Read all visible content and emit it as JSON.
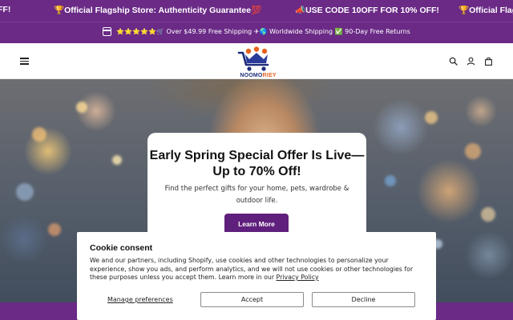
{
  "announcement": {
    "items": [
      "FF!",
      "🏆Official Flagship Store: Authenticity Guarantee💯",
      "📣USE CODE 10OFF FOR 10% OFF!",
      "🏆Official Flagsh"
    ]
  },
  "shipping_bar": {
    "icon": "calendar-icon",
    "text": "⭐⭐⭐⭐⭐🛒 Over $49.99 Free Shipping ✈🌎 Worldwide Shipping ✅ 90-Day Free Returns"
  },
  "header": {
    "logo_text_primary": "NOOMO",
    "logo_text_accent": "RIEY",
    "icons": [
      "menu-icon",
      "search-icon",
      "account-icon",
      "cart-icon"
    ],
    "brand_colors": {
      "navy": "#1f2c7a",
      "orange": "#e8621f"
    }
  },
  "hero": {
    "title": "Early Spring Special Offer Is Live— Up to 70% Off!",
    "subtitle": "Find the perfect gifts for your home, pets, wardrobe & outdoor life.",
    "cta_label": "Learn More",
    "accent_color": "#6a2a86"
  },
  "cookie_banner": {
    "title": "Cookie consent",
    "body": "We and our partners, including Shopify, use cookies and other technologies to personalize your experience, show you ads, and perform analytics, and we will not use cookies or other technologies for these purposes unless you accept them. Learn more in our",
    "policy_link": "Privacy Policy",
    "manage_label": "Manage preferences",
    "accept_label": "Accept",
    "decline_label": "Decline"
  }
}
